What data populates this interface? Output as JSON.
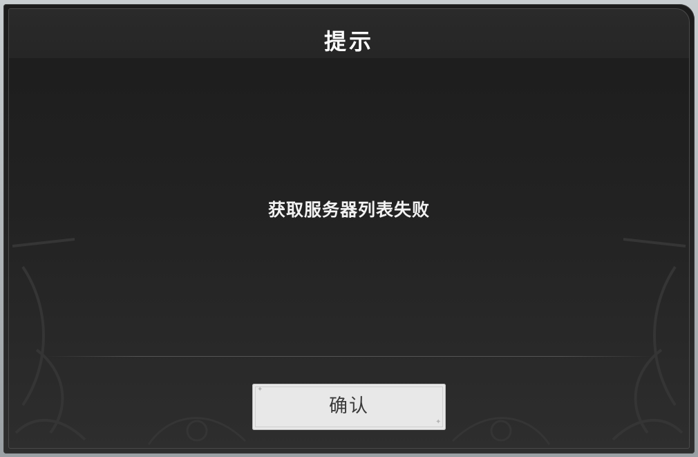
{
  "dialog": {
    "title": "提示",
    "message": "获取服务器列表失败",
    "confirm_label": "确认"
  },
  "colors": {
    "background": "#222222",
    "title_text": "#ffffff",
    "message_text": "#f2f2f2",
    "button_background": "#e8e8e8",
    "button_text": "#3a3a3a"
  },
  "icons": {
    "decoration": "ornate-scroll-pattern"
  }
}
